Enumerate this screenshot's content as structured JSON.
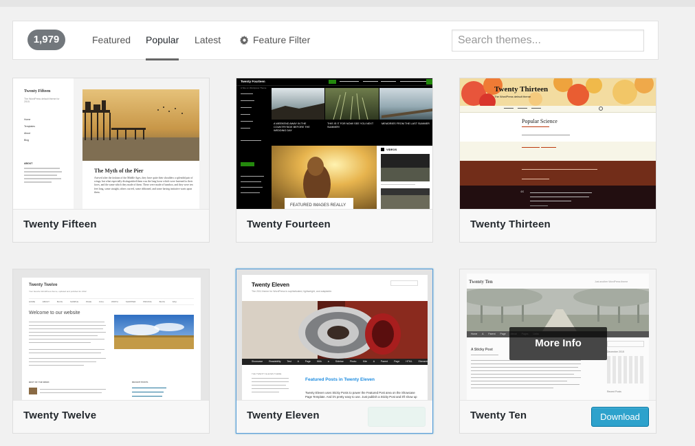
{
  "filter_bar": {
    "theme_count": "1,979",
    "tabs": [
      {
        "label": "Featured",
        "active": false
      },
      {
        "label": "Popular",
        "active": true
      },
      {
        "label": "Latest",
        "active": false
      }
    ],
    "feature_filter_label": "Feature Filter",
    "search_placeholder": "Search themes..."
  },
  "themes": [
    {
      "name": "Twenty Fifteen",
      "preview": {
        "site_title": "Twenty Fifteen",
        "tagline": "The WordPress default theme for 2015.",
        "nav": [
          "Home",
          "Templates",
          "About",
          "Blog"
        ],
        "about_heading": "ABOUT",
        "post_title": "The Myth of the Pier",
        "post_excerpt": "Arrived after the fashion of the Middle Ages, they have quite their shoulders a splendid pair of wings; but what especially distinguished them was the long loose which were fastened to their faces, and the same which they made of them. These were made of bamboo, and they were ten feet long, some straight, others curved, some ribboned, and some having imitative warts upon them."
      }
    },
    {
      "name": "Twenty Fourteen",
      "preview": {
        "site_title": "Twenty Fourteen",
        "tagline": "A Site on Wordpress Theme",
        "captions": [
          "A WEEKEND AWAY IN THE COUNTRYSIDE BEFORE THE WEDDING DAY",
          "THIS IS IT FOR NOW! SEE YOU NEXT SUMMER!",
          "MEMORIES FROM THE LAST SUMMER"
        ],
        "featured_caption": "FEATURED IMAGES REALLY",
        "videos_label": "VIDEOS"
      }
    },
    {
      "name": "Twenty Thirteen",
      "preview": {
        "site_title": "Twenty Thirteen",
        "tagline": "The WordPress default theme",
        "post_title": "Popular Science"
      }
    },
    {
      "name": "Twenty Twelve",
      "preview": {
        "site_title": "Twenty Twelve",
        "tagline": "Your favorite WordPress theme, updated and polished for 2012",
        "nav": [
          "HOME",
          "ABOUT",
          "BLOG",
          "SAMPLE PAGE",
          "FULL WIDTH",
          "SHOPPER",
          "PRICING",
          "BLOG",
          "FAQ"
        ],
        "welcome": "Welcome to our website",
        "recent_posts_label": "RECENT POSTS"
      }
    },
    {
      "name": "Twenty Eleven",
      "focused": true,
      "preview": {
        "site_title": "Twenty Eleven",
        "tagline": "The 2011 theme for WordPress is sophisticated, lightweight, and adaptable.",
        "nav": [
          "Showcase",
          "Readability Test",
          "A Page With a Sidebar",
          "Photo: Kite",
          "A Parent Page",
          "HTML Elements"
        ],
        "featured_heading": "Featured Posts in Twenty Eleven",
        "side_label": "THE TWENTY ELEVEN THEME",
        "post_excerpt": "Twenty Eleven uses Sticky Posts to power the Featured Post area on the Showcase Page Template. And it's pretty easy to use. Just publish a Sticky Post and it'll show up"
      }
    },
    {
      "name": "Twenty Ten",
      "preview": {
        "site_title": "Twenty Ten",
        "tagline": "Just another WordPress theme",
        "nav": [
          "Home",
          "A Parent Page",
          "About",
          "Pages",
          "Links"
        ],
        "post_title": "A Sticky Post",
        "calendar_label": "December 2015",
        "recent_posts_label": "Recent Posts"
      },
      "overlay_label": "More Info",
      "action_label": "Download"
    }
  ],
  "colors": {
    "accent": "#2ea2cc",
    "count_badge": "#72777c",
    "focus_border": "#5b9dd9"
  }
}
